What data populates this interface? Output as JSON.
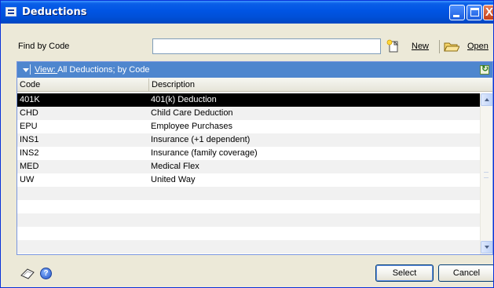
{
  "window": {
    "title": "Deductions",
    "controls": {
      "minimize": "_",
      "maximize": "□",
      "close": "X"
    }
  },
  "find": {
    "label": "Find by Code",
    "value": "",
    "placeholder": ""
  },
  "toolbar": {
    "new_label": "New",
    "open_label": "Open",
    "new_icon": "new-document-icon",
    "open_icon": "open-folder-icon"
  },
  "view_bar": {
    "prefix": "View: ",
    "text": "All Deductions; by Code",
    "refresh_icon": "refresh-icon"
  },
  "table": {
    "columns": [
      "Code",
      "Description"
    ],
    "rows": [
      {
        "code": "401K",
        "description": "401(k) Deduction",
        "selected": true
      },
      {
        "code": "CHD",
        "description": "Child Care Deduction",
        "selected": false
      },
      {
        "code": "EPU",
        "description": "Employee Purchases",
        "selected": false
      },
      {
        "code": "INS1",
        "description": "Insurance (+1 dependent)",
        "selected": false
      },
      {
        "code": "INS2",
        "description": "Insurance (family coverage)",
        "selected": false
      },
      {
        "code": "MED",
        "description": "Medical Flex",
        "selected": false
      },
      {
        "code": "UW",
        "description": "United Way",
        "selected": false
      }
    ],
    "empty_rows": 5
  },
  "footer": {
    "note_icon": "note-icon",
    "help_icon": "help-icon",
    "help_glyph": "?",
    "select_label": "Select",
    "cancel_label": "Cancel"
  },
  "colors": {
    "title_bar": "#0054e3",
    "view_bar": "#4e86ce",
    "selected_row": "#000000"
  }
}
